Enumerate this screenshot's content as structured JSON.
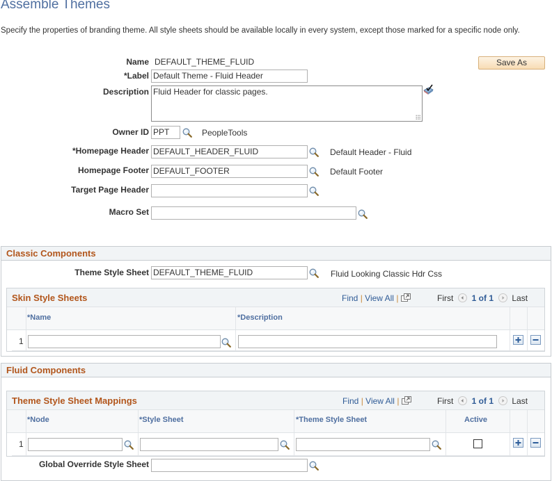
{
  "page": {
    "title": "Assemble Themes",
    "intro": "Specify the properties of branding theme. All style sheets should be available locally in every system, except those marked for a specific node only."
  },
  "toolbar": {
    "save_as_label": "Save As"
  },
  "form": {
    "name_label": "Name",
    "name_value": "DEFAULT_THEME_FLUID",
    "label_label": "*Label",
    "label_value": "Default Theme - Fluid Header",
    "description_label": "Description",
    "description_value": "Fluid Header for classic pages.",
    "owner_label": "Owner ID",
    "owner_value": "PPT",
    "owner_desc": "PeopleTools",
    "hp_header_label": "*Homepage Header",
    "hp_header_value": "DEFAULT_HEADER_FLUID",
    "hp_header_desc": "Default Header - Fluid",
    "hp_footer_label": "Homepage Footer",
    "hp_footer_value": "DEFAULT_FOOTER",
    "hp_footer_desc": "Default Footer",
    "target_header_label": "Target Page Header",
    "target_header_value": "",
    "macro_label": "Macro Set",
    "macro_value": ""
  },
  "classic": {
    "title": "Classic Components",
    "theme_ss_label": "Theme Style Sheet",
    "theme_ss_value": "DEFAULT_THEME_FLUID",
    "theme_ss_desc": "Fluid Looking Classic Hdr Css",
    "skin_grid": {
      "title": "Skin Style Sheets",
      "find": "Find",
      "sep": "|",
      "view_all": "View All",
      "first": "First",
      "counter": "1 of 1",
      "last": "Last",
      "columns": [
        "*Name",
        "*Description"
      ],
      "rows": [
        {
          "num": "1",
          "name": "",
          "description": ""
        }
      ]
    }
  },
  "fluid": {
    "title": "Fluid Components",
    "mapping_grid": {
      "title": "Theme Style Sheet Mappings",
      "find": "Find",
      "sep": "|",
      "view_all": "View All",
      "first": "First",
      "counter": "1 of 1",
      "last": "Last",
      "columns": [
        "*Node",
        "*Style Sheet",
        "*Theme Style Sheet",
        "Active"
      ],
      "rows": [
        {
          "num": "1",
          "node": "",
          "style_sheet": "",
          "theme_style_sheet": "",
          "active": false
        }
      ]
    },
    "global_override_label": "Global Override Style Sheet",
    "global_override_value": ""
  },
  "colors": {
    "title_blue": "#4f6fa0",
    "section_orange": "#b2561c",
    "link_blue": "#2f5b96"
  }
}
